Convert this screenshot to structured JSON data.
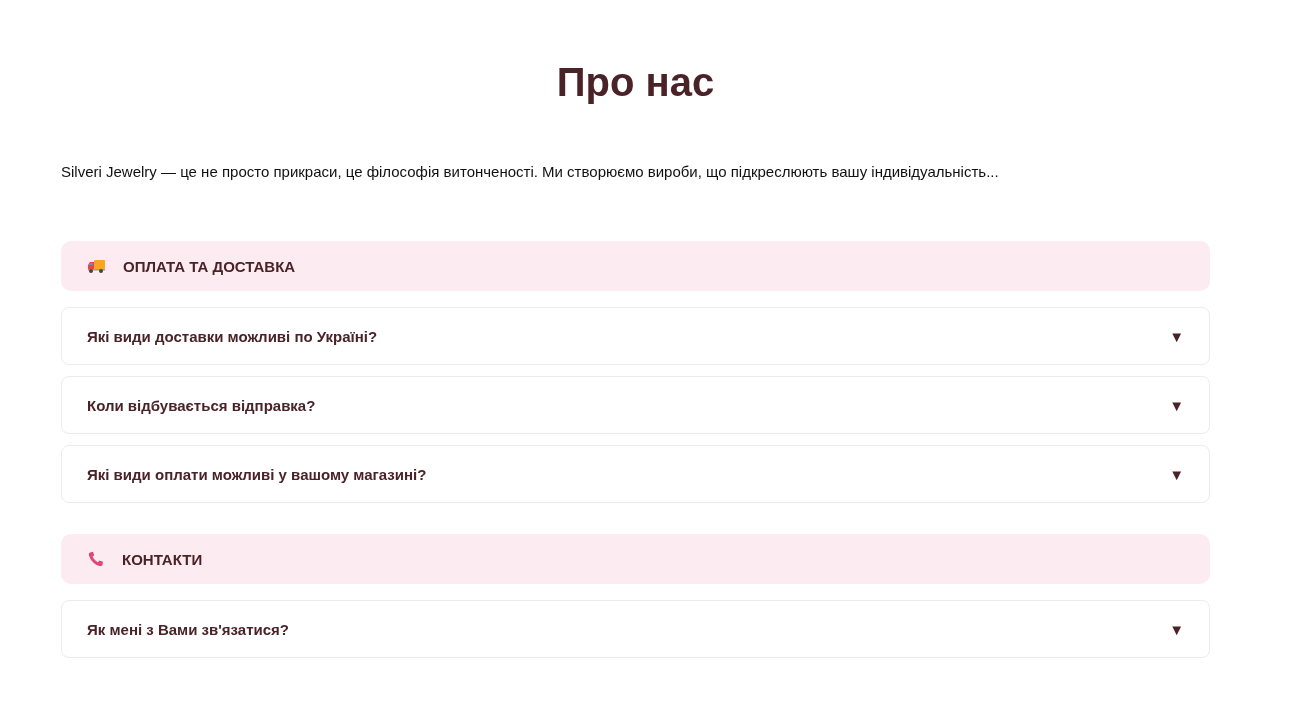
{
  "title": "Про нас",
  "intro": "Silveri Jewelry — це не просто прикраси, це філософія витонченості. Ми створюємо вироби, що підкреслюють вашу індивідуальність...",
  "sections": [
    {
      "kind": "delivery",
      "heading": "ОПЛАТА ТА ДОСТАВКА",
      "questions": [
        {
          "text": "Які види доставки можливі по Україні?",
          "toggle": "▼",
          "expanded": false
        },
        {
          "text": "Коли відбувається відправка?",
          "toggle": "▼",
          "expanded": false
        },
        {
          "text": "Які види оплати можливі у вашому магазині?",
          "toggle": "▼",
          "expanded": false
        }
      ]
    },
    {
      "kind": "contacts",
      "heading": "КОНТАКТИ",
      "questions": [
        {
          "text": "Як мені з Вами зв'язатися?",
          "toggle": "▼",
          "expanded": false
        }
      ]
    }
  ]
}
